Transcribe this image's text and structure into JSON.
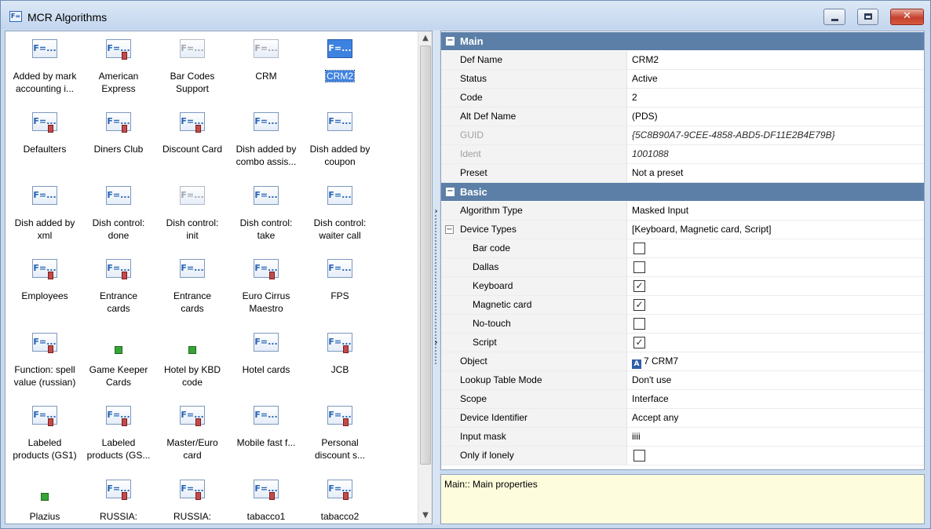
{
  "window": {
    "title": "MCR Algorithms",
    "icon_text": "F=",
    "close_glyph": "✕"
  },
  "tiles": [
    {
      "label": "Added by mark\naccounting i...",
      "icon": "F=...",
      "style": "normal",
      "badge": false
    },
    {
      "label": "American\nExpress",
      "icon": "F=...",
      "style": "normal",
      "badge": true
    },
    {
      "label": "Bar Codes\nSupport",
      "icon": "F=...",
      "style": "grey",
      "badge": false
    },
    {
      "label": "CRM",
      "icon": "F=...",
      "style": "grey",
      "badge": false
    },
    {
      "label": "CRM2",
      "icon": "F=...",
      "style": "selected",
      "badge": false
    },
    {
      "label": "Defaulters",
      "icon": "F=...",
      "style": "normal",
      "badge": true
    },
    {
      "label": "Diners Club",
      "icon": "F=...",
      "style": "normal",
      "badge": true
    },
    {
      "label": "Discount Card",
      "icon": "F=...",
      "style": "normal",
      "badge": true
    },
    {
      "label": "Dish added by\ncombo assis...",
      "icon": "F=...",
      "style": "normal",
      "badge": false
    },
    {
      "label": "Dish added by\ncoupon",
      "icon": "F=...",
      "style": "normal",
      "badge": false
    },
    {
      "label": "Dish added by\nxml",
      "icon": "F=...",
      "style": "normal",
      "badge": false
    },
    {
      "label": "Dish control:\ndone",
      "icon": "F=...",
      "style": "normal",
      "badge": false
    },
    {
      "label": "Dish control:\ninit",
      "icon": "F=...",
      "style": "grey",
      "badge": false
    },
    {
      "label": "Dish control:\ntake",
      "icon": "F=...",
      "style": "normal",
      "badge": false
    },
    {
      "label": "Dish control:\nwaiter call",
      "icon": "F=...",
      "style": "normal",
      "badge": false
    },
    {
      "label": "Employees",
      "icon": "F=...",
      "style": "normal",
      "badge": true
    },
    {
      "label": "Entrance\ncards",
      "icon": "F=...",
      "style": "normal",
      "badge": true
    },
    {
      "label": "Entrance\ncards",
      "icon": "F=...",
      "style": "normal",
      "badge": false
    },
    {
      "label": "Euro Cirrus\nMaestro",
      "icon": "F=...",
      "style": "normal",
      "badge": true
    },
    {
      "label": "FPS",
      "icon": "F=...",
      "style": "normal",
      "badge": false
    },
    {
      "label": "Function: spell\nvalue (russian)",
      "icon": "F=...",
      "style": "normal",
      "badge": true
    },
    {
      "label": "Game Keeper\nCards",
      "icon": "",
      "style": "green",
      "badge": false
    },
    {
      "label": "Hotel by KBD\ncode",
      "icon": "",
      "style": "green",
      "badge": false
    },
    {
      "label": "Hotel cards",
      "icon": "F=...",
      "style": "normal",
      "badge": false
    },
    {
      "label": "JCB",
      "icon": "F=...",
      "style": "normal",
      "badge": true
    },
    {
      "label": "Labeled\nproducts (GS1)",
      "icon": "F=...",
      "style": "normal",
      "badge": true
    },
    {
      "label": "Labeled\nproducts (GS...",
      "icon": "F=...",
      "style": "normal",
      "badge": true
    },
    {
      "label": "Master/Euro\ncard",
      "icon": "F=...",
      "style": "normal",
      "badge": true
    },
    {
      "label": "Mobile fast f...",
      "icon": "F=...",
      "style": "normal",
      "badge": false
    },
    {
      "label": "Personal\ndiscount s...",
      "icon": "F=...",
      "style": "normal",
      "badge": true
    },
    {
      "label": "Plazius",
      "icon": "",
      "style": "green",
      "badge": false
    },
    {
      "label": "RUSSIA:",
      "icon": "F=...",
      "style": "normal",
      "badge": true
    },
    {
      "label": "RUSSIA:",
      "icon": "F=...",
      "style": "normal",
      "badge": true
    },
    {
      "label": "tabacco1",
      "icon": "F=...",
      "style": "normal",
      "badge": true
    },
    {
      "label": "tabacco2",
      "icon": "F=...",
      "style": "normal",
      "badge": true
    }
  ],
  "scroll": {
    "up": "▲",
    "down": "▼"
  },
  "splitter": {
    "arrow": "›"
  },
  "properties": {
    "sections": [
      {
        "title": "Main",
        "rows": [
          {
            "key": "Def Name",
            "value": "CRM2",
            "type": "text"
          },
          {
            "key": "Status",
            "value": "Active",
            "type": "text"
          },
          {
            "key": "Code",
            "value": "2",
            "type": "text"
          },
          {
            "key": "Alt Def Name",
            "value": "(PDS)",
            "type": "text"
          },
          {
            "key": "GUID",
            "value": "{5C8B90A7-9CEE-4858-ABD5-DF11E2B4E79B}",
            "type": "readonly"
          },
          {
            "key": "Ident",
            "value": "1001088",
            "type": "readonly"
          },
          {
            "key": "Preset",
            "value": "Not a preset",
            "type": "text"
          }
        ]
      },
      {
        "title": "Basic",
        "rows": [
          {
            "key": "Algorithm Type",
            "value": "Masked Input",
            "type": "text"
          },
          {
            "key": "Device Types",
            "value": "[Keyboard, Magnetic card, Script]",
            "type": "expander",
            "expander": "−"
          },
          {
            "key": "Bar code",
            "value": "",
            "type": "check",
            "checked": false
          },
          {
            "key": "Dallas",
            "value": "",
            "type": "check",
            "checked": false
          },
          {
            "key": "Keyboard",
            "value": "",
            "type": "check",
            "checked": true
          },
          {
            "key": "Magnetic card",
            "value": "",
            "type": "check",
            "checked": true
          },
          {
            "key": "No-touch",
            "value": "",
            "type": "check",
            "checked": false
          },
          {
            "key": "Script",
            "value": "",
            "type": "check",
            "checked": true
          },
          {
            "key": "Object",
            "value": "7 CRM7",
            "type": "object",
            "icon": "A"
          },
          {
            "key": "Lookup Table Mode",
            "value": "Don't use",
            "type": "text"
          },
          {
            "key": "Scope",
            "value": "Interface",
            "type": "text"
          },
          {
            "key": "Device Identifier",
            "value": "Accept any",
            "type": "text"
          },
          {
            "key": "Input mask",
            "value": "iiii",
            "type": "text"
          },
          {
            "key": "Only if lonely",
            "value": "",
            "type": "check",
            "checked": false
          }
        ]
      }
    ],
    "collapse_glyph": "−",
    "check_glyph": "✓"
  },
  "description": "Main:: Main properties"
}
